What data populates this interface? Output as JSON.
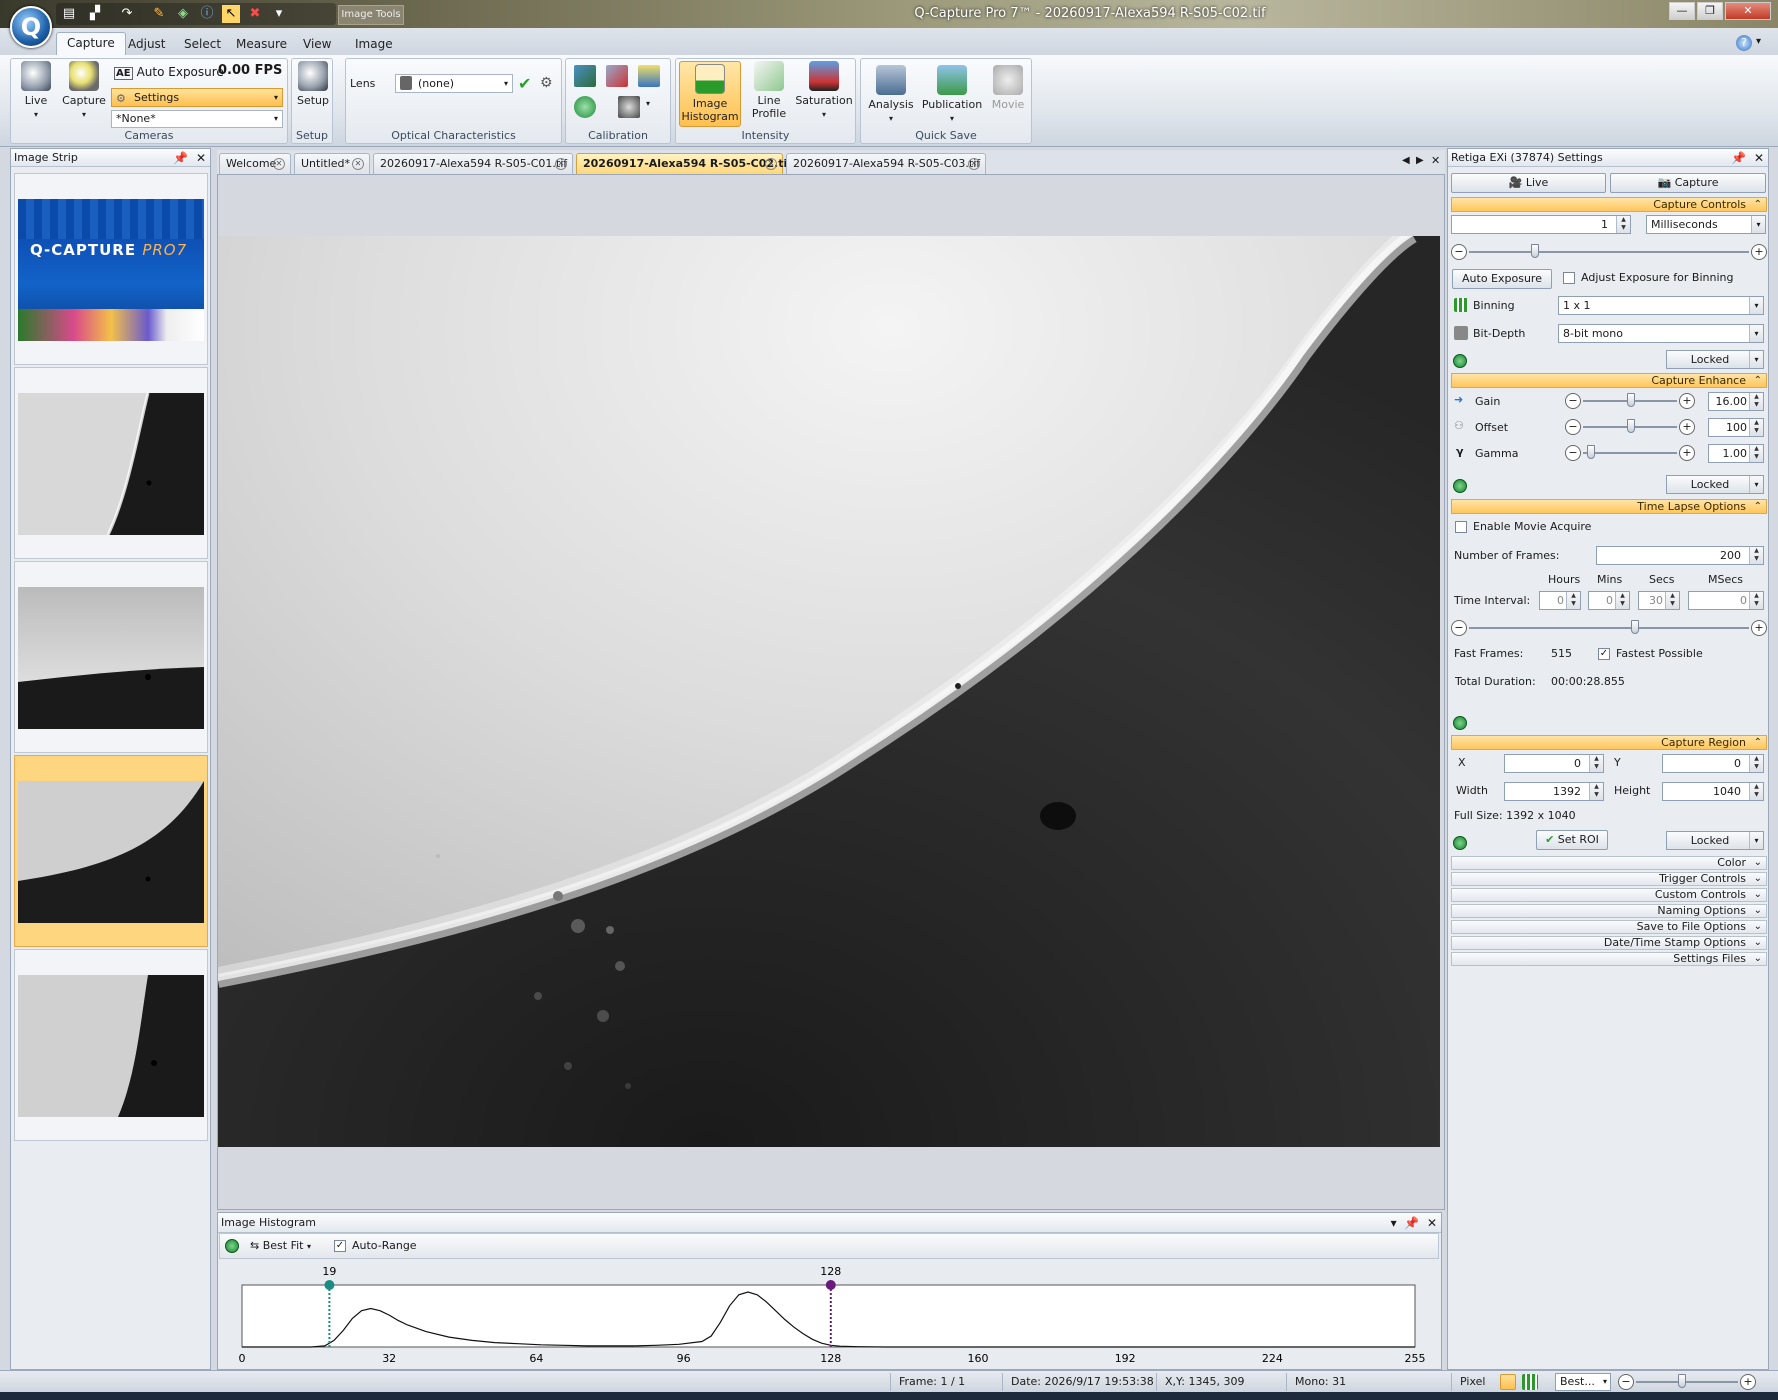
{
  "window": {
    "title": "Q-Capture Pro 7™ - 20260917-Alexa594 R-S05-C02.tif",
    "context_tab": "Image Tools",
    "logo_letter": "Q"
  },
  "quick_access": {
    "icons": [
      "new-window-icon",
      "stamp-icon",
      "redo-icon",
      "paint-icon",
      "layers-icon",
      "info-icon",
      "pointer-icon",
      "close-red-icon",
      "more-icon"
    ]
  },
  "ribbon": {
    "tabs": [
      "Capture",
      "Adjust",
      "Select",
      "Measure",
      "View",
      "Image"
    ],
    "active_tab": "Capture",
    "cameras": {
      "live": "Live",
      "capture": "Capture",
      "auto_exposure": "Auto Exposure",
      "fps": "0.00 FPS",
      "settings": "Settings",
      "preset": "*None*",
      "label": "Cameras"
    },
    "setup": {
      "button": "Setup",
      "label": "Setup"
    },
    "optical": {
      "lens_label": "Lens",
      "lens_value": "(none)",
      "label": "Optical Characteristics"
    },
    "calibration": {
      "label": "Calibration"
    },
    "intensity": {
      "image_histogram": "Image Histogram",
      "line_profile": "Line Profile",
      "saturation": "Saturation",
      "label": "Intensity"
    },
    "quick_save": {
      "analysis": "Analysis",
      "publication": "Publication",
      "movie": "Movie",
      "label": "Quick Save"
    }
  },
  "image_strip": {
    "title": "Image Strip",
    "splash": {
      "brand": "Q-CAPTURE",
      "version": "PRO7"
    }
  },
  "doc_tabs": [
    {
      "label": "Welcome"
    },
    {
      "label": "Untitled*"
    },
    {
      "label": "20260917-Alexa594 R-S05-C01.tif"
    },
    {
      "label": "20260917-Alexa594 R-S05-C02.tif"
    },
    {
      "label": "20260917-Alexa594 R-S05-C03.tif"
    }
  ],
  "active_doc": 3,
  "histogram": {
    "title": "Image Histogram",
    "best_fit": "Best Fit",
    "auto_range": "Auto-Range",
    "auto_range_checked": true,
    "low_marker": "19",
    "high_marker": "128",
    "ticks": [
      "0",
      "32",
      "64",
      "96",
      "128",
      "160",
      "192",
      "224",
      "255"
    ]
  },
  "chart_data": {
    "type": "area",
    "title": "",
    "xlabel": "",
    "ylabel": "",
    "xlim": [
      0,
      255
    ],
    "x": [
      0,
      15,
      18,
      20,
      22,
      24,
      26,
      28,
      30,
      32,
      34,
      36,
      40,
      45,
      50,
      55,
      60,
      65,
      70,
      75,
      80,
      85,
      90,
      95,
      100,
      102,
      104,
      106,
      108,
      110,
      112,
      114,
      116,
      118,
      120,
      122,
      124,
      126,
      128,
      130,
      134,
      140,
      150,
      200,
      255
    ],
    "series": [
      {
        "values": [
          0,
          0,
          0.02,
          0.12,
          0.3,
          0.52,
          0.66,
          0.7,
          0.66,
          0.58,
          0.48,
          0.4,
          0.28,
          0.18,
          0.12,
          0.08,
          0.06,
          0.04,
          0.03,
          0.02,
          0.02,
          0.02,
          0.03,
          0.05,
          0.1,
          0.2,
          0.45,
          0.75,
          0.95,
          1.0,
          0.95,
          0.82,
          0.66,
          0.5,
          0.36,
          0.24,
          0.14,
          0.07,
          0.03,
          0.015,
          0.005,
          0,
          0,
          0,
          0
        ]
      }
    ],
    "markers": [
      19,
      128
    ]
  },
  "settings": {
    "title": "Retiga EXi (37874) Settings",
    "live": "Live",
    "capture": "Capture",
    "capture_controls": {
      "header": "Capture Controls",
      "exposure": "1",
      "unit": "Milliseconds",
      "auto_exposure": "Auto Exposure",
      "adjust_binning": "Adjust Exposure for Binning",
      "binning_label": "Binning",
      "binning": "1 x 1",
      "bitdepth_label": "Bit-Depth",
      "bitdepth": "8-bit mono",
      "locked": "Locked"
    },
    "capture_enhance": {
      "header": "Capture Enhance",
      "gain_label": "Gain",
      "gain": "16.00",
      "offset_label": "Offset",
      "offset": "100",
      "gamma_label": "Gamma",
      "gamma": "1.00",
      "locked": "Locked"
    },
    "time_lapse": {
      "header": "Time Lapse Options",
      "enable": "Enable Movie Acquire",
      "frames_label": "Number of  Frames:",
      "frames": "200",
      "hours": "Hours",
      "mins": "Mins",
      "secs": "Secs",
      "msecs": "MSecs",
      "interval_label": "Time Interval:",
      "h": "0",
      "m": "0",
      "s": "30",
      "ms": "0",
      "fast_label": "Fast Frames:",
      "fast_value": "515",
      "fastest": "Fastest Possible",
      "duration_label": "Total Duration:",
      "duration": "00:00:28.855"
    },
    "capture_region": {
      "header": "Capture Region",
      "x_label": "X",
      "x": "0",
      "y_label": "Y",
      "y": "0",
      "width_label": "Width",
      "width": "1392",
      "height_label": "Height",
      "height": "1040",
      "full_size": "Full Size: 1392 x 1040",
      "set_roi": "Set ROI",
      "locked": "Locked"
    },
    "collapsed": [
      "Color",
      "Trigger Controls",
      "Custom Controls",
      "Naming Options",
      "Save to File Options",
      "Date/Time Stamp Options",
      "Settings Files"
    ]
  },
  "status": {
    "frame": "Frame: 1 / 1",
    "date": "Date: 2026/9/17 19:53:38",
    "xy": "X,Y: 1345,  309",
    "mono": "Mono:   31",
    "pixel": "Pixel",
    "zoom": "Best..."
  },
  "colors": {
    "accent": "#ffc65c",
    "selected": "#ffd680",
    "ribbon": "#dde3ea"
  }
}
